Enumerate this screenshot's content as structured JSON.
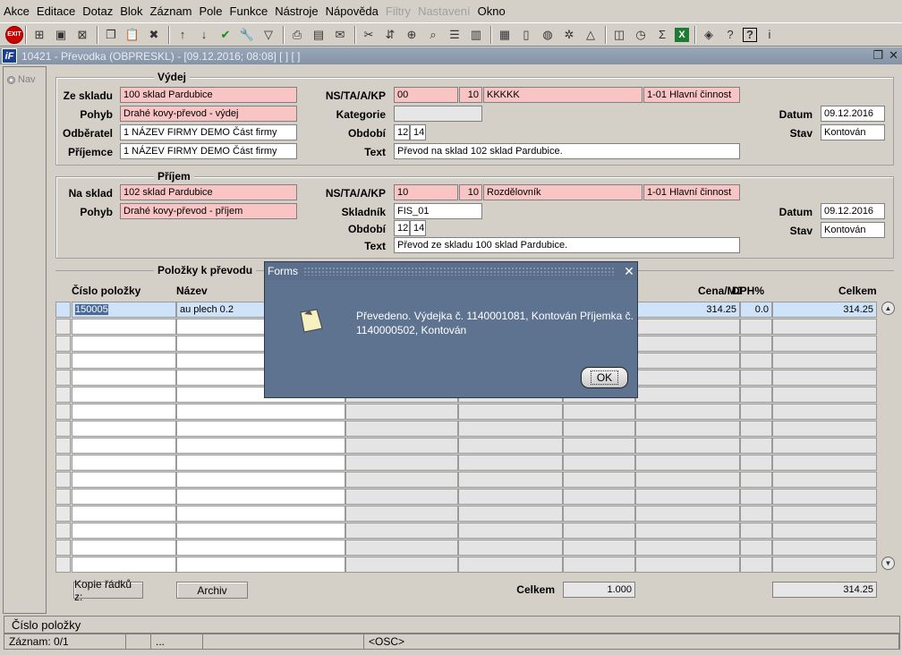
{
  "menu": [
    "Akce",
    "Editace",
    "Dotaz",
    "Blok",
    "Záznam",
    "Pole",
    "Funkce",
    "Nástroje",
    "Nápověda",
    "Filtry",
    "Nastavení",
    "Okno"
  ],
  "menu_disabled": [
    "Filtry",
    "Nastavení"
  ],
  "toolbar": {
    "exit_label": "EXIT",
    "icons": [
      "add-record-icon",
      "save-icon",
      "delete-record-icon",
      "copy-icon",
      "paste-icon",
      "remove-icon",
      "sort-asc-icon",
      "sort-desc-icon",
      "check-icon",
      "wrench-icon",
      "filter-icon",
      "print-icon",
      "print-preview-icon",
      "mail-icon",
      "cut-icon",
      "navigate-icon",
      "attach-icon",
      "zoom-icon",
      "list-icon",
      "columns-icon",
      "clipboard-icon",
      "document-icon",
      "globe-icon",
      "settings-icon",
      "triangle-icon",
      "chart-icon",
      "clock-icon",
      "sum-icon",
      "excel-icon",
      "network-icon",
      "help-hint-icon",
      "help-icon",
      "info-icon"
    ]
  },
  "window": {
    "title": "10421 - Převodka (OBPRESKL) - [09.12.2016; 08:08]  [ ]  [ ]"
  },
  "nav_label": "Nav",
  "vydej": {
    "legend": "Výdej",
    "ze_skladu_label": "Ze skladu",
    "ze_skladu": "100 sklad Pardubice",
    "pohyb_label": "Pohyb",
    "pohyb": "Drahé kovy-převod - výdej",
    "odberatel_label": "Odběratel",
    "odberatel": "1 NÁZEV FIRMY DEMO Část firmy",
    "prijemce_label": "Příjemce",
    "prijemce": "1 NÁZEV FIRMY DEMO Část firmy",
    "ns_label": "NS/TA/A/KP",
    "ns": "00",
    "ta": "10",
    "a": "KKKKK",
    "kp": "1-01 Hlavní činnost",
    "kategorie_label": "Kategorie",
    "kategorie": "",
    "obdobi_label": "Období",
    "obdobi_m": "12",
    "obdobi_y": "14",
    "text_label": "Text",
    "text": "Převod na sklad 102 sklad Pardubice.",
    "datum_label": "Datum",
    "datum": "09.12.2016",
    "stav_label": "Stav",
    "stav": "Kontován"
  },
  "prijem": {
    "legend": "Příjem",
    "na_sklad_label": "Na sklad",
    "na_sklad": "102 sklad Pardubice",
    "pohyb_label": "Pohyb",
    "pohyb": "Drahé kovy-převod - příjem",
    "ns_label": "NS/TA/A/KP",
    "ns": "10",
    "ta": "10",
    "a": "Rozdělovník",
    "kp": "1-01 Hlavní činnost",
    "skladnik_label": "Skladník",
    "skladnik": "FIS_01",
    "obdobi_label": "Období",
    "obdobi_m": "12",
    "obdobi_y": "14",
    "text_label": "Text",
    "text": "Převod ze skladu 100 sklad Pardubice.",
    "datum_label": "Datum",
    "datum": "09.12.2016",
    "stav_label": "Stav",
    "stav": "Kontován"
  },
  "polozky": {
    "legend": "Položky k převodu",
    "col_cislo": "Číslo položky",
    "col_nazev": "Název",
    "col_cena": "Cena/MJ",
    "col_dph": "DPH%",
    "col_celkem": "Celkem",
    "row1": {
      "cislo": "150005",
      "nazev": "au plech 0.2",
      "cena": "314.25",
      "dph": "0.0",
      "celkem": "314.25"
    },
    "kopie_btn": "Kopie řádků z:",
    "archiv_btn": "Archiv",
    "celkem_label": "Celkem",
    "celkem_mnozstvi": "1.000",
    "celkem_castka": "314.25"
  },
  "dialog": {
    "title": "Forms",
    "message": "Převedeno. Výdejka č. 1140001081, Kontován Příjemka č. 1140000502, Kontován",
    "ok": "OK"
  },
  "status": {
    "line1": "Číslo položky",
    "zaznam": "Záznam: 0/1",
    "dots": "...",
    "osc": "<OSC>"
  }
}
